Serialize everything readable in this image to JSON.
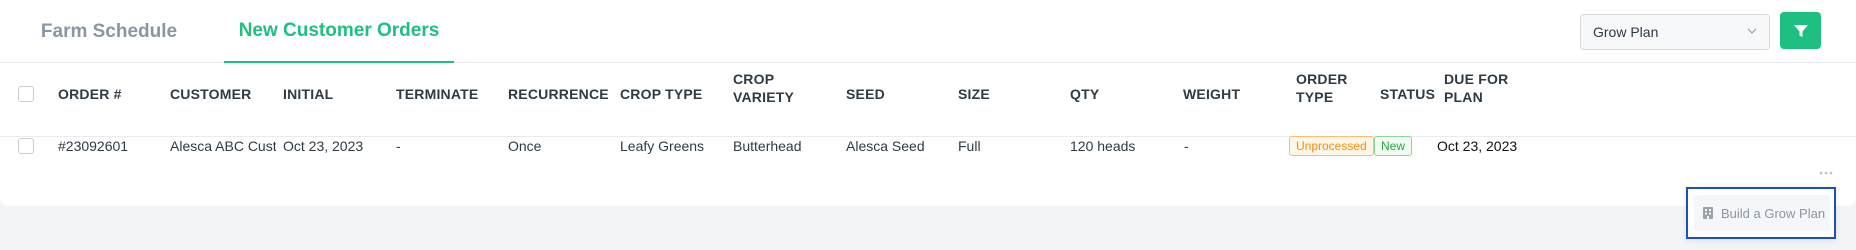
{
  "tabs": [
    {
      "label": "Farm Schedule",
      "active": false
    },
    {
      "label": "New Customer Orders",
      "active": true
    }
  ],
  "toolbar": {
    "plan_select_value": "Grow Plan",
    "filter_icon": "funnel-icon"
  },
  "colors": {
    "accent": "#1fbf82",
    "unprocessed": "#f08c1a",
    "new": "#28a745",
    "focus_border": "#1f4fbf"
  },
  "table": {
    "columns": [
      "ORDER #",
      "CUSTOMER",
      "INITIAL",
      "TERMINATE",
      "RECURRENCE",
      "CROP TYPE",
      "CROP VARIETY",
      "SEED",
      "SIZE",
      "QTY",
      "WEIGHT",
      "ORDER TYPE",
      "STATUS",
      "DUE FOR PLAN"
    ],
    "rows": [
      {
        "order": "#23092601",
        "customer": "Alesca ABC Custom",
        "initial": "Oct 23, 2023",
        "terminate": "-",
        "recurrence": "Once",
        "crop_type": "Leafy Greens",
        "crop_variety": "Butterhead",
        "seed": "Alesca Seed",
        "size": "Full",
        "qty": "120 heads",
        "weight": "-",
        "order_type": "Unprocessed",
        "status": "New",
        "due_for_plan": "Oct 23, 2023"
      }
    ]
  },
  "row_menu": {
    "items": [
      {
        "label": "Build a Grow Plan",
        "icon": "building-icon"
      }
    ]
  }
}
